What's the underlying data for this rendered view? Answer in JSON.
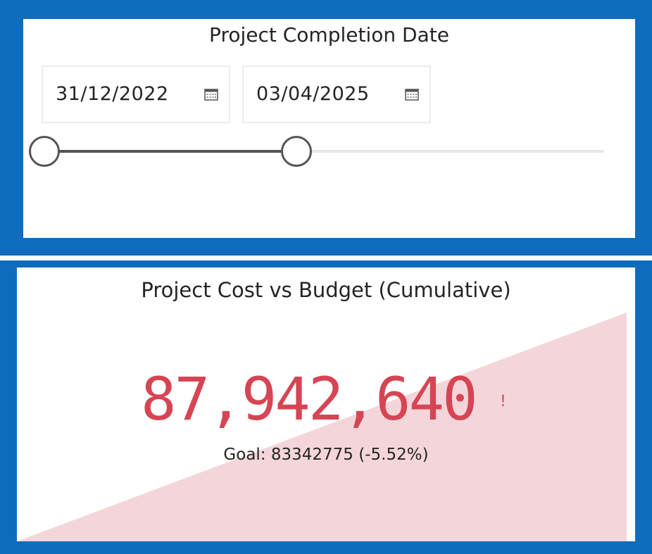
{
  "colors": {
    "frame": "#0f6cbd",
    "kpi_value": "#d64554",
    "kpi_trend_fill": "#f4d6da",
    "slider_active": "#555555",
    "slider_track": "#e6e6e6"
  },
  "slicer": {
    "title": "Project Completion Date",
    "start_date": "31/12/2022",
    "end_date": "03/04/2025",
    "start_icon": "calendar-icon",
    "end_icon": "calendar-icon",
    "range_start_fraction": 0,
    "range_end_fraction": 0.45
  },
  "kpi": {
    "title": "Project Cost vs Budget (Cumulative)",
    "value": "87,942,640",
    "alert_symbol": "!",
    "goal_text": "Goal: 83342775 (-5.52%)"
  }
}
